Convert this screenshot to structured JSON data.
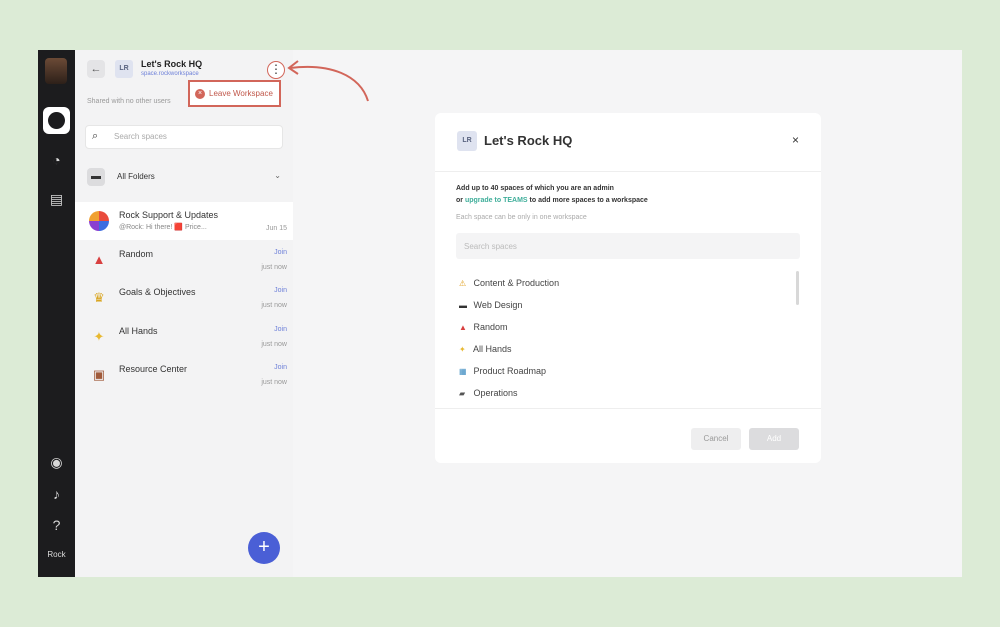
{
  "rail": {
    "footer_label": "Rock",
    "icons": [
      "avatar",
      "workspace-icon",
      "clock-icon",
      "document-icon",
      "user-icon",
      "bell-icon",
      "help-icon"
    ]
  },
  "sidebar": {
    "back_icon": "←",
    "workspace_badge": "LR",
    "workspace_name": "Let's Rock HQ",
    "workspace_sub": "space.rockworkspace",
    "more_icon": "⋮",
    "shared_text": "Shared with no other users",
    "search_placeholder": "Search spaces",
    "folders_label": "All Folders",
    "items": [
      {
        "name": "Rock Support & Updates",
        "sub": "@Rock: Hi there! 🟥 Price...",
        "time": "Jun 15",
        "join": ""
      },
      {
        "name": "Random",
        "sub": "",
        "time": "just now",
        "join": "Join"
      },
      {
        "name": "Goals & Objectives",
        "sub": "",
        "time": "just now",
        "join": "Join"
      },
      {
        "name": "All Hands",
        "sub": "",
        "time": "just now",
        "join": "Join"
      },
      {
        "name": "Resource Center",
        "sub": "",
        "time": "just now",
        "join": "Join"
      }
    ],
    "fab_label": "+"
  },
  "popup": {
    "leave_label": "Leave Workspace"
  },
  "modal": {
    "badge": "LR",
    "title": "Let's Rock HQ",
    "close": "×",
    "line1": "Add up to 40 spaces of which you are an admin",
    "line2_prefix": "or",
    "line2_link": "upgrade to TEAMS",
    "line2_suffix": "to add more spaces to a workspace",
    "line3": "Each space can be only in one workspace",
    "search_placeholder": "Search spaces",
    "spaces": [
      {
        "icon": "⚠",
        "label": "Content & Production"
      },
      {
        "icon": "▬",
        "label": "Web Design"
      },
      {
        "icon": "▲",
        "label": "Random"
      },
      {
        "icon": "✦",
        "label": "All Hands"
      },
      {
        "icon": "▦",
        "label": "Product Roadmap"
      },
      {
        "icon": "▰",
        "label": "Operations"
      }
    ],
    "cancel_label": "Cancel",
    "add_label": "Add"
  },
  "colors": {
    "accent": "#d2665a",
    "primary": "#4a5fd6",
    "link": "#3fae9a"
  }
}
